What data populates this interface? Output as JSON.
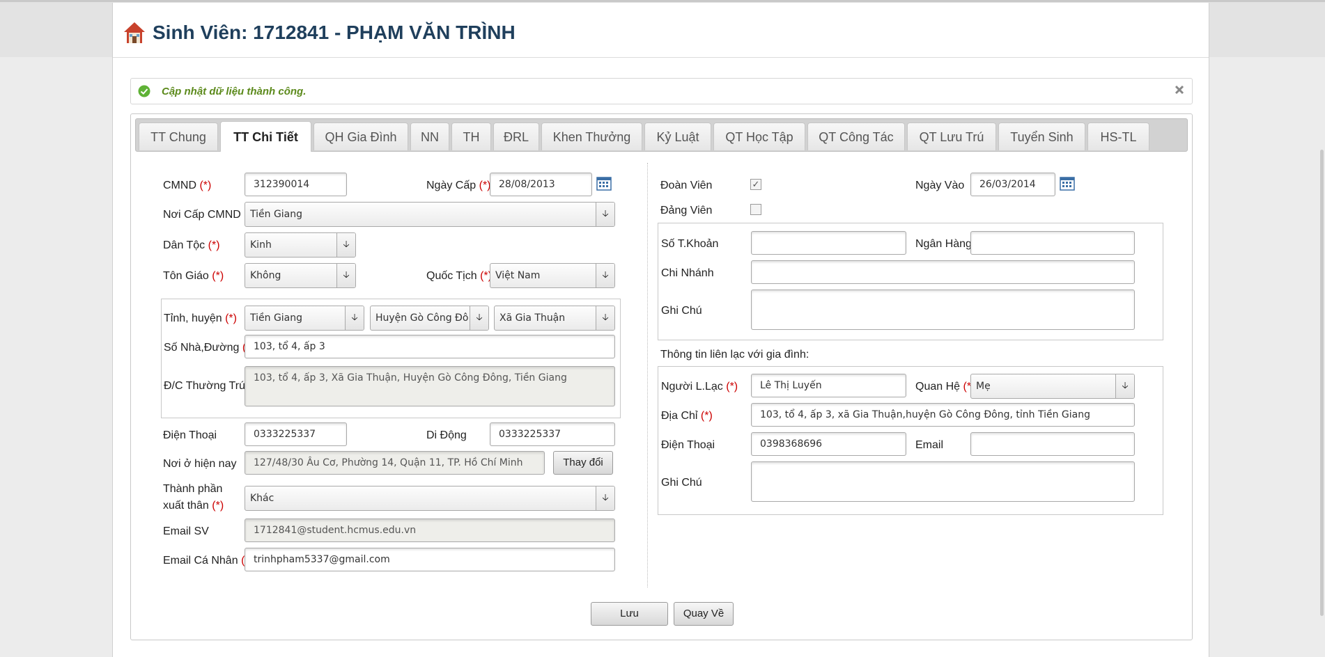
{
  "header": {
    "title": "Sinh Viên: 1712841 - PHẠM VĂN TRÌNH"
  },
  "alert": {
    "message": "Cập nhật dữ liệu thành công."
  },
  "tabs": [
    {
      "label": "TT Chung"
    },
    {
      "label": "TT Chi Tiết"
    },
    {
      "label": "QH Gia Đình"
    },
    {
      "label": "NN"
    },
    {
      "label": "TH"
    },
    {
      "label": "ĐRL"
    },
    {
      "label": "Khen Thưởng"
    },
    {
      "label": "Kỷ Luật"
    },
    {
      "label": "QT Học Tập"
    },
    {
      "label": "QT Công Tác"
    },
    {
      "label": "QT Lưu Trú"
    },
    {
      "label": "Tuyển Sinh"
    },
    {
      "label": "HS-TL"
    }
  ],
  "active_tab": "TT Chi Tiết",
  "required_mark": "(*)",
  "left": {
    "cmnd": {
      "label": "CMND",
      "value": "312390014"
    },
    "ngay_cap": {
      "label": "Ngày Cấp",
      "value": "28/08/2013"
    },
    "noi_cap": {
      "label": "Nơi Cấp CMND",
      "value": "Tiền Giang"
    },
    "dan_toc": {
      "label": "Dân Tộc",
      "value": "Kinh"
    },
    "ton_giao": {
      "label": "Tôn Giáo",
      "value": "Không"
    },
    "quoc_tich": {
      "label": "Quốc Tịch",
      "value": "Việt Nam"
    },
    "tinh_huyen": {
      "label": "Tỉnh, huyện",
      "tinh": "Tiền Giang",
      "huyen": "Huyện Gò Công Đô",
      "xa": "Xã Gia Thuận"
    },
    "so_nha": {
      "label": "Số Nhà,Đường",
      "value": "103, tổ 4, ấp 3"
    },
    "dc_thuong_tru": {
      "label": "Đ/C Thường Trú",
      "value": "103, tổ 4, ấp 3, Xã Gia Thuận, Huyện Gò Công Đông, Tiền Giang"
    },
    "dien_thoai": {
      "label": "Điện Thoại",
      "value": "0333225337"
    },
    "di_dong": {
      "label": "Di Động",
      "value": "0333225337"
    },
    "noi_o": {
      "label": "Nơi ở hiện nay",
      "value": "127/48/30 Âu Cơ, Phường 14, Quận 11, TP. Hồ Chí Minh",
      "button": "Thay đổi"
    },
    "thanh_phan": {
      "label_line1": "Thành phần",
      "label_line2": "xuất thân",
      "value": "Khác"
    },
    "email_sv": {
      "label": "Email SV",
      "value": "1712841@student.hcmus.edu.vn"
    },
    "email_cn": {
      "label": "Email Cá Nhân",
      "value": "trinhpham5337@gmail.com"
    }
  },
  "right": {
    "doan_vien": {
      "label": "Đoàn Viên",
      "checked": true,
      "mark": "✓"
    },
    "ngay_vao": {
      "label": "Ngày Vào",
      "value": "26/03/2014"
    },
    "dang_vien": {
      "label": "Đảng Viên",
      "checked": false
    },
    "so_tk": {
      "label": "Số T.Khoản",
      "value": ""
    },
    "ngan_hang": {
      "label": "Ngân Hàng",
      "value": ""
    },
    "chi_nhanh": {
      "label": "Chi Nhánh",
      "value": ""
    },
    "ghi_chu": {
      "label": "Ghi Chú",
      "value": ""
    },
    "family_heading": "Thông tin liên lạc với gia đình:",
    "nguoi_lien_lac": {
      "label": "Người L.Lạc",
      "value": "Lê Thị Luyến"
    },
    "quan_he": {
      "label": "Quan Hệ",
      "value": "Mẹ"
    },
    "dia_chi": {
      "label": "Địa Chỉ",
      "value": "103, tổ 4, ấp 3, xã Gia Thuận,huyện Gò Công Đông, tỉnh Tiền Giang"
    },
    "dien_thoai": {
      "label": "Điện Thoại",
      "value": "0398368696"
    },
    "email": {
      "label": "Email",
      "value": ""
    },
    "ghi_chu_gd": {
      "label": "Ghi Chú",
      "value": ""
    }
  },
  "actions": {
    "save": "Lưu",
    "back": "Quay Về"
  },
  "icons": {
    "dropdown_arrow": "🡣"
  }
}
